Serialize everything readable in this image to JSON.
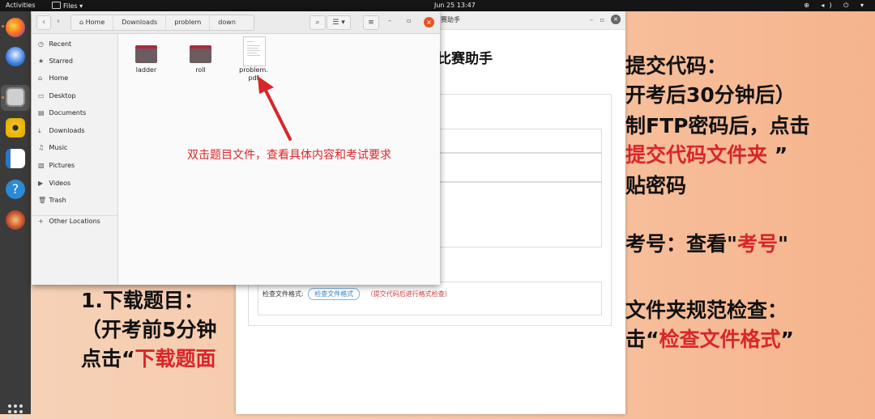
{
  "topbar": {
    "activities": "Activities",
    "app_menu": "Files ▾",
    "clock": "Jun 25  13:47",
    "tray": "⊕ ◂) ⏻ ▾"
  },
  "background_text": {
    "right_line1": "提交代码：",
    "right_line2": "开考后30分钟后）",
    "right_line3": "制FTP密码后，点击",
    "right_line4_red": "提交代码文件夹",
    "right_line4_end": "”",
    "right_line5": "贴密码",
    "right_exam_prefix": "考号：查看\"",
    "right_exam_red": "考号",
    "right_exam_suffix": "\"",
    "right_check1": "文件夹规范检查：",
    "right_check2_prefix": "击“",
    "right_check2_red": "检查文件格式",
    "right_check2_suffix": "”",
    "left_line1": "1.下载题目：",
    "left_line2": "（开考前5分钟",
    "left_line3_prefix": "点击“",
    "left_line3_red": "下载题面"
  },
  "assistant_window": {
    "title": "赛助手",
    "heading": "比赛助手",
    "check_label": "检查文件格式:",
    "check_button": "检查文件格式",
    "check_hint": "（提交代码后进行格式检查）"
  },
  "file_manager": {
    "back": "‹",
    "forward": "›",
    "breadcrumb": [
      "Home",
      "Downloads",
      "problem",
      "down"
    ],
    "search_icon": "search-icon",
    "sidebar": [
      {
        "icon": "◷",
        "label": "Recent"
      },
      {
        "icon": "★",
        "label": "Starred"
      },
      {
        "icon": "⌂",
        "label": "Home"
      },
      {
        "icon": "▭",
        "label": "Desktop"
      },
      {
        "icon": "▤",
        "label": "Documents"
      },
      {
        "icon": "⤓",
        "label": "Downloads"
      },
      {
        "icon": "♫",
        "label": "Music"
      },
      {
        "icon": "▧",
        "label": "Pictures"
      },
      {
        "icon": "▶",
        "label": "Videos"
      },
      {
        "icon": "🗑",
        "label": "Trash"
      },
      {
        "icon": "+",
        "label": "Other Locations"
      }
    ],
    "items": [
      {
        "name": "ladder",
        "type": "folder"
      },
      {
        "name": "roll",
        "type": "folder"
      },
      {
        "name": "problem.\npdf",
        "type": "pdf"
      }
    ],
    "folder_color": "#6b5c5f",
    "accent": "#e95420"
  },
  "annotation": {
    "text": "双击题目文件，查看具体内容和考试要求",
    "color": "#d8262a"
  }
}
